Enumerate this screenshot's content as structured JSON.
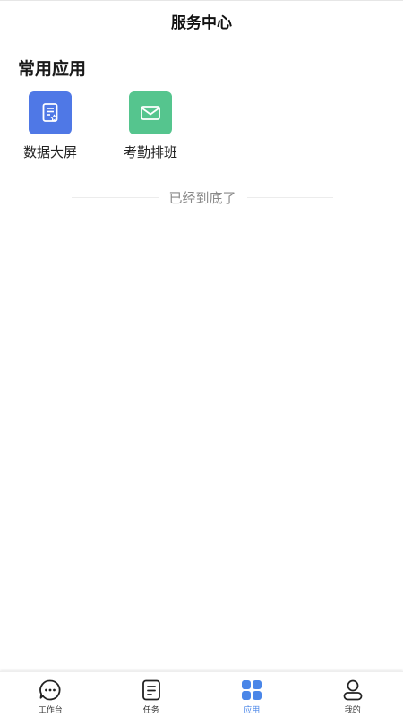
{
  "header": {
    "title": "服务中心"
  },
  "section": {
    "title": "常用应用"
  },
  "apps": [
    {
      "label": "数据大屏",
      "icon": "data-screen-icon",
      "color": "#4f78e6"
    },
    {
      "label": "考勤排班",
      "icon": "mail-icon",
      "color": "#55c58e"
    }
  ],
  "end_text": "已经到底了",
  "tabbar": {
    "active_index": 2,
    "active_color": "#4a86e8",
    "items": [
      {
        "label": "工作台",
        "icon": "chat-bubble-icon"
      },
      {
        "label": "任务",
        "icon": "task-list-icon"
      },
      {
        "label": "应用",
        "icon": "app-grid-icon"
      },
      {
        "label": "我的",
        "icon": "user-icon"
      }
    ]
  }
}
